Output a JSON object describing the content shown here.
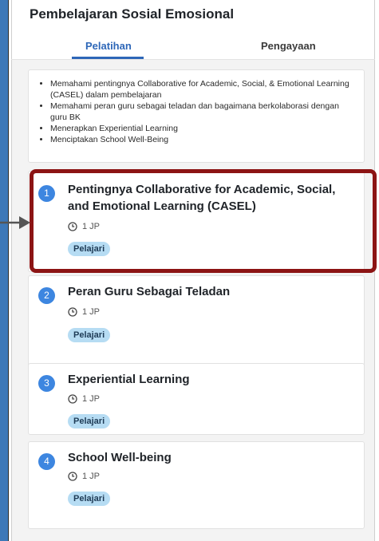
{
  "page": {
    "title": "Pembelajaran Sosial Emosional"
  },
  "tabs": [
    {
      "label": "Pelatihan",
      "active": true
    },
    {
      "label": "Pengayaan",
      "active": false
    }
  ],
  "objectives": [
    "Memahami pentingnya Collaborative for Academic, Social, & Emotional Learning (CASEL) dalam pembelajaran",
    "Memahami peran guru sebagai teladan dan bagaimana berkolaborasi dengan guru BK",
    "Menerapkan Experiential Learning",
    "Menciptakan School Well-Being"
  ],
  "modules": [
    {
      "number": "1",
      "title": "Pentingnya Collaborative for Academic, Social, and Emotional Learning (CASEL)",
      "duration": "1 JP",
      "button": "Pelajari",
      "highlighted": true
    },
    {
      "number": "2",
      "title": "Peran Guru Sebagai Teladan",
      "duration": "1 JP",
      "button": "Pelajari"
    },
    {
      "number": "3",
      "title": "Experiential Learning",
      "duration": "1 JP",
      "button": "Pelajari"
    },
    {
      "number": "4",
      "title": "School Well-being",
      "duration": "1 JP",
      "button": "Pelajari"
    }
  ],
  "colors": {
    "accent": "#2e67b8",
    "badge": "#3d86e0",
    "pill_bg": "#b6dcf3",
    "highlight_border": "#8c1414",
    "left_strip": "#3d78b8"
  },
  "icons": {
    "duration": "clock-icon",
    "pointer": "arrow-right-icon"
  }
}
